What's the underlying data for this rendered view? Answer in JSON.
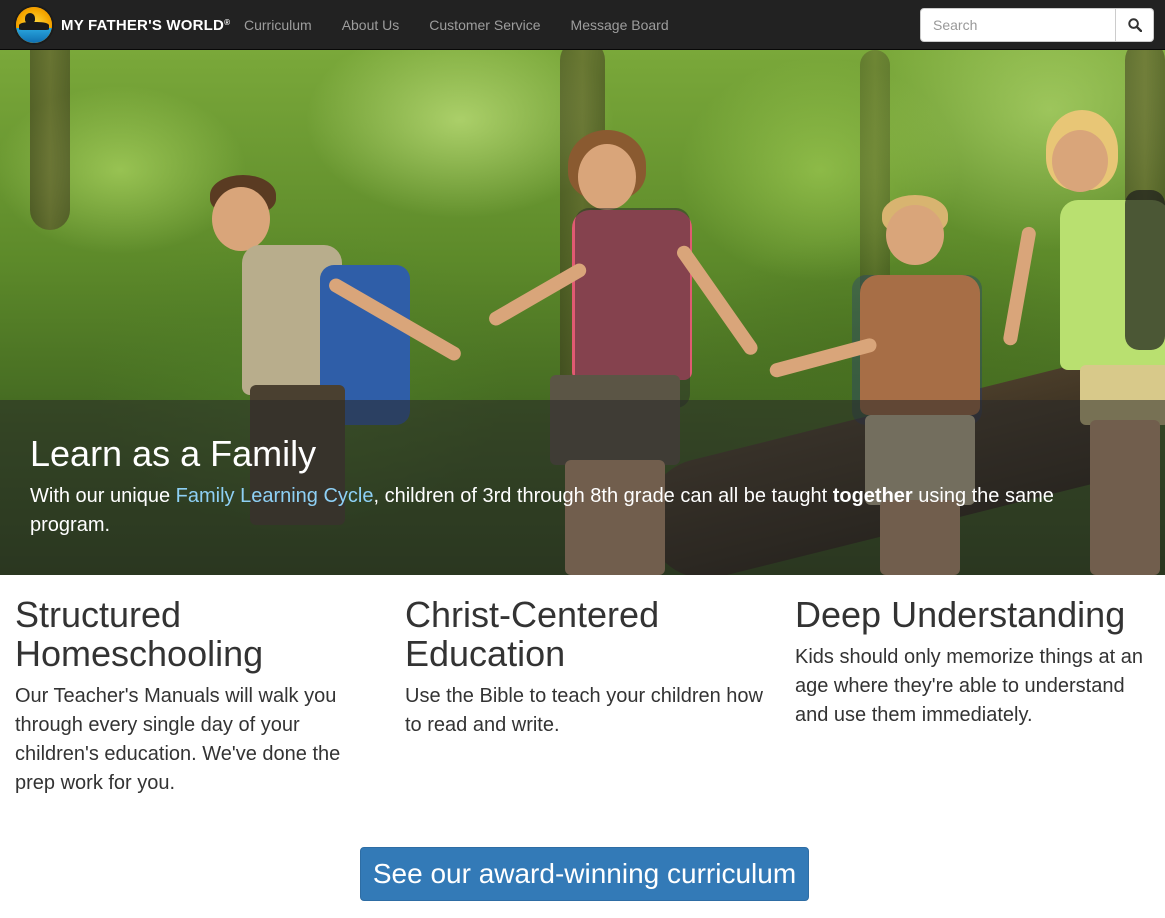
{
  "navbar": {
    "brand_name": "My Father's World",
    "brand_text_main": "MY FATHER'S WORLD",
    "brand_mark": "®",
    "links": [
      {
        "label": "Curriculum"
      },
      {
        "label": "About Us"
      },
      {
        "label": "Customer Service"
      },
      {
        "label": "Message Board"
      }
    ],
    "search": {
      "placeholder": "Search",
      "value": "",
      "icon": "search-icon"
    }
  },
  "hero": {
    "title": "Learn as a Family",
    "text_before": "With our unique ",
    "link_text": "Family Learning Cycle",
    "text_middle": ", children of 3rd through 8th grade can all be taught ",
    "bold_text": "together",
    "text_after": " using the same program."
  },
  "features": [
    {
      "title": "Structured Homeschooling",
      "text": "Our Teacher's Manuals will walk you through every single day of your children's education. We've done the prep work for you."
    },
    {
      "title": "Christ-Centered Education",
      "text": "Use the Bible to teach your children how to read and write."
    },
    {
      "title": "Deep Understanding",
      "text": "Kids should only memorize things at an age where they're able to understand and use them immediately."
    }
  ],
  "cta": {
    "label": "See our award-winning curriculum"
  },
  "colors": {
    "navbar_bg": "#222222",
    "nav_link": "#9d9d9d",
    "accent": "#337ab7",
    "hero_link": "#8ed0f5"
  }
}
